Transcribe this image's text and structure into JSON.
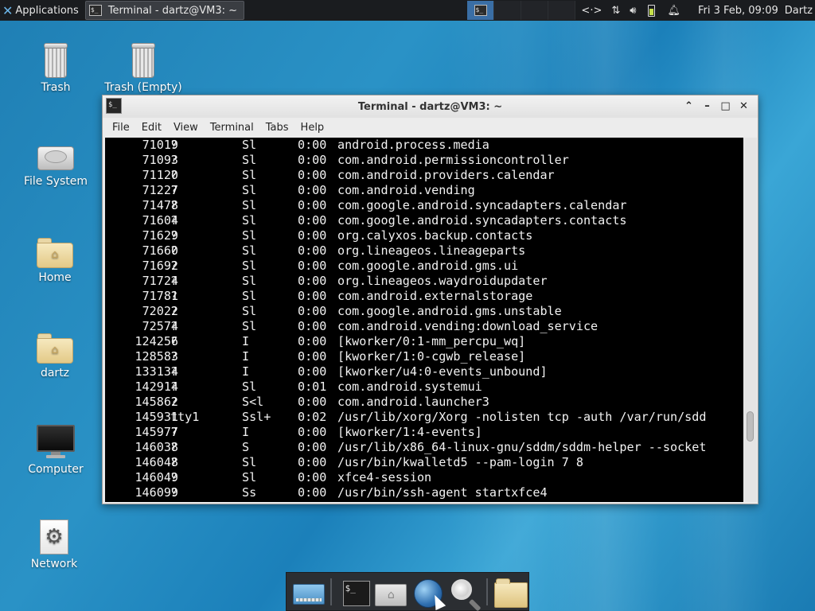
{
  "top_panel": {
    "applications_label": "Applications",
    "taskbar_window_title": "Terminal - dartz@VM3: ~",
    "network_icon": "<·>",
    "clock": "Fri  3 Feb, 09:09",
    "user": "Dartz"
  },
  "desktop_icons": [
    {
      "label": "Trash"
    },
    {
      "label": "Trash (Empty)"
    },
    {
      "label": "File System"
    },
    {
      "label": "Home"
    },
    {
      "label": "dartz"
    },
    {
      "label": "Computer"
    },
    {
      "label": "Network"
    }
  ],
  "terminal": {
    "title": "Terminal - dartz@VM3: ~",
    "menu": [
      "File",
      "Edit",
      "View",
      "Terminal",
      "Tabs",
      "Help"
    ],
    "rows": [
      {
        "pid": "71019",
        "tty": "?",
        "stat": "Sl",
        "time": "0:00",
        "cmd": "android.process.media"
      },
      {
        "pid": "71093",
        "tty": "?",
        "stat": "Sl",
        "time": "0:00",
        "cmd": "com.android.permissioncontroller"
      },
      {
        "pid": "71120",
        "tty": "?",
        "stat": "Sl",
        "time": "0:00",
        "cmd": "com.android.providers.calendar"
      },
      {
        "pid": "71227",
        "tty": "?",
        "stat": "Sl",
        "time": "0:00",
        "cmd": "com.android.vending"
      },
      {
        "pid": "71478",
        "tty": "?",
        "stat": "Sl",
        "time": "0:00",
        "cmd": "com.google.android.syncadapters.calendar"
      },
      {
        "pid": "71604",
        "tty": "?",
        "stat": "Sl",
        "time": "0:00",
        "cmd": "com.google.android.syncadapters.contacts"
      },
      {
        "pid": "71629",
        "tty": "?",
        "stat": "Sl",
        "time": "0:00",
        "cmd": "org.calyxos.backup.contacts"
      },
      {
        "pid": "71660",
        "tty": "?",
        "stat": "Sl",
        "time": "0:00",
        "cmd": "org.lineageos.lineageparts"
      },
      {
        "pid": "71692",
        "tty": "?",
        "stat": "Sl",
        "time": "0:00",
        "cmd": "com.google.android.gms.ui"
      },
      {
        "pid": "71724",
        "tty": "?",
        "stat": "Sl",
        "time": "0:00",
        "cmd": "org.lineageos.waydroidupdater"
      },
      {
        "pid": "71781",
        "tty": "?",
        "stat": "Sl",
        "time": "0:00",
        "cmd": "com.android.externalstorage"
      },
      {
        "pid": "72022",
        "tty": "?",
        "stat": "Sl",
        "time": "0:00",
        "cmd": "com.google.android.gms.unstable"
      },
      {
        "pid": "72574",
        "tty": "?",
        "stat": "Sl",
        "time": "0:00",
        "cmd": "com.android.vending:download_service"
      },
      {
        "pid": "124256",
        "tty": "?",
        "stat": "I",
        "time": "0:00",
        "cmd": "[kworker/0:1-mm_percpu_wq]"
      },
      {
        "pid": "128583",
        "tty": "?",
        "stat": "I",
        "time": "0:00",
        "cmd": "[kworker/1:0-cgwb_release]"
      },
      {
        "pid": "133134",
        "tty": "?",
        "stat": "I",
        "time": "0:00",
        "cmd": "[kworker/u4:0-events_unbound]"
      },
      {
        "pid": "142914",
        "tty": "?",
        "stat": "Sl",
        "time": "0:01",
        "cmd": "com.android.systemui"
      },
      {
        "pid": "145862",
        "tty": "?",
        "stat": "S<l",
        "time": "0:00",
        "cmd": "com.android.launcher3"
      },
      {
        "pid": "145931",
        "tty": "tty1",
        "stat": "Ssl+",
        "time": "0:02",
        "cmd": "/usr/lib/xorg/Xorg -nolisten tcp -auth /var/run/sdd"
      },
      {
        "pid": "145977",
        "tty": "?",
        "stat": "I",
        "time": "0:00",
        "cmd": "[kworker/1:4-events]"
      },
      {
        "pid": "146038",
        "tty": "?",
        "stat": "S",
        "time": "0:00",
        "cmd": "/usr/lib/x86_64-linux-gnu/sddm/sddm-helper --socket"
      },
      {
        "pid": "146048",
        "tty": "?",
        "stat": "Sl",
        "time": "0:00",
        "cmd": "/usr/bin/kwalletd5 --pam-login 7 8"
      },
      {
        "pid": "146049",
        "tty": "?",
        "stat": "Sl",
        "time": "0:00",
        "cmd": "xfce4-session"
      },
      {
        "pid": "146099",
        "tty": "?",
        "stat": "Ss",
        "time": "0:00",
        "cmd": "/usr/bin/ssh-agent startxfce4"
      }
    ]
  },
  "dock": {
    "terminal_icon_text": "$_"
  },
  "icons": {
    "applications": "xfce-logo-icon",
    "network_tray": "network-arrows-icon",
    "transfer": "up-down-arrows-icon",
    "volume": "speaker-icon",
    "battery": "battery-icon",
    "notifications": "bell-icon"
  }
}
